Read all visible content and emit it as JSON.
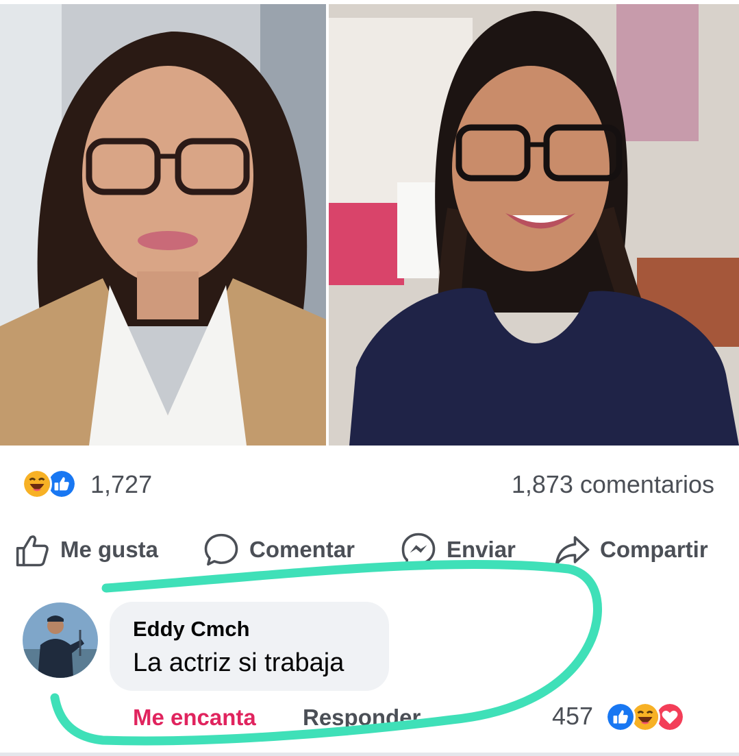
{
  "post": {
    "photos": [
      {
        "name": "left-photo"
      },
      {
        "name": "right-photo"
      }
    ],
    "reactions": {
      "icons": [
        "haha-icon",
        "like-icon"
      ],
      "count": "1,727"
    },
    "comments_count": "1,873 comentarios",
    "actions": [
      {
        "label": "Me gusta",
        "icon": "thumbs-up-icon"
      },
      {
        "label": "Comentar",
        "icon": "comment-bubble-icon"
      },
      {
        "label": "Enviar",
        "icon": "messenger-icon"
      },
      {
        "label": "Compartir",
        "icon": "share-arrow-icon"
      }
    ]
  },
  "comment": {
    "author": "Eddy Cmch",
    "text": "La actriz si trabaja",
    "love_label": "Me encanta",
    "reply_label": "Responder",
    "reaction_count": "457",
    "reaction_icons": [
      "like-icon",
      "haha-icon",
      "love-icon"
    ]
  },
  "colors": {
    "like_blue": "#1877f2",
    "love_red": "#f33e58",
    "haha_yellow": "#f7b125",
    "love_label_color": "#e0245e",
    "annotation_stroke": "#3fe0b8"
  }
}
